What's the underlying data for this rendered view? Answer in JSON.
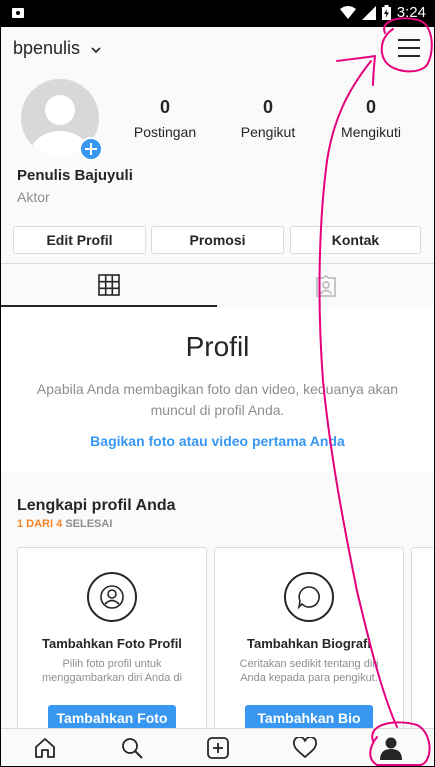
{
  "statusbar": {
    "time": "3:24"
  },
  "header": {
    "username": "bpenulis"
  },
  "profile": {
    "stats": [
      {
        "value": "0",
        "label": "Postingan"
      },
      {
        "value": "0",
        "label": "Pengikut"
      },
      {
        "value": "0",
        "label": "Mengikuti"
      }
    ],
    "name": "Penulis Bajuyuli",
    "bio": "Aktor"
  },
  "buttons": {
    "edit": "Edit Profil",
    "promo": "Promosi",
    "contact": "Kontak"
  },
  "empty_state": {
    "title": "Profil",
    "description": "Apabila Anda membagikan foto dan video, keduanya akan muncul di profil Anda.",
    "cta": "Bagikan foto atau video pertama Anda"
  },
  "complete_profile": {
    "title": "Lengkapi profil Anda",
    "progress_done": "1 DARI 4",
    "progress_rest": "SELESAI",
    "cards": [
      {
        "title": "Tambahkan Foto Profil",
        "desc": "Pilih foto profil untuk menggambarkan diri Anda di",
        "button": "Tambahkan Foto"
      },
      {
        "title": "Tambahkan Biografi",
        "desc": "Ceritakan sedikit tentang diri Anda kepada para pengikut.",
        "button": "Tambahkan Bio"
      }
    ]
  },
  "colors": {
    "accent": "#3897f0",
    "annotation": "#e6007e",
    "progress": "#f58529"
  }
}
